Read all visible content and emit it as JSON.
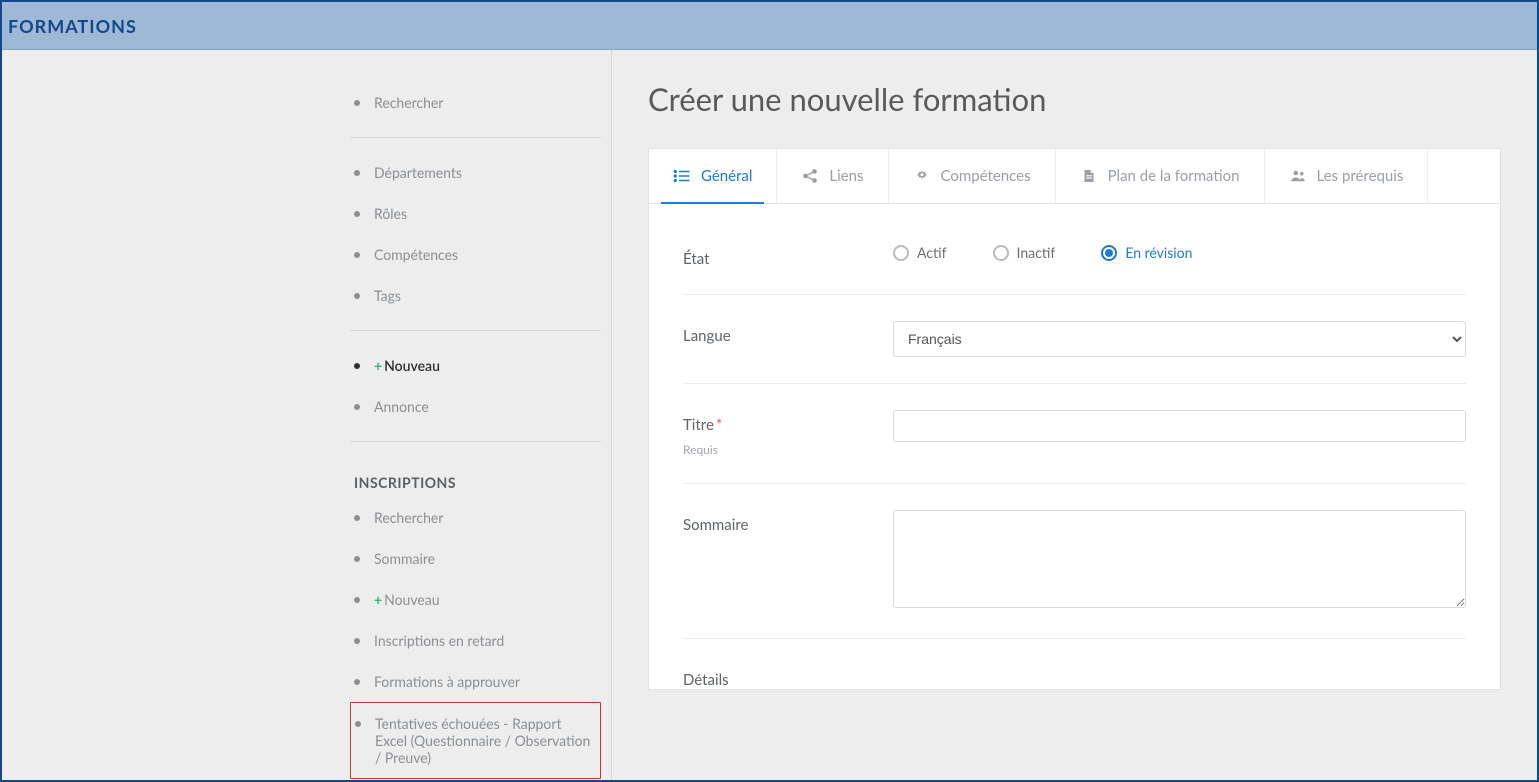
{
  "header": {
    "title": "FORMATIONS"
  },
  "sidebar": {
    "group1": [
      {
        "label": "Rechercher",
        "active": false,
        "plus": false
      }
    ],
    "group2": [
      {
        "label": "Départements",
        "active": false,
        "plus": false
      },
      {
        "label": "Rôles",
        "active": false,
        "plus": false
      },
      {
        "label": "Compétences",
        "active": false,
        "plus": false
      },
      {
        "label": "Tags",
        "active": false,
        "plus": false
      }
    ],
    "group3": [
      {
        "label": "Nouveau",
        "active": true,
        "plus": true
      },
      {
        "label": "Annonce",
        "active": false,
        "plus": false
      }
    ],
    "section_title": "INSCRIPTIONS",
    "group4": [
      {
        "label": "Rechercher",
        "active": false,
        "plus": false
      },
      {
        "label": "Sommaire",
        "active": false,
        "plus": false
      },
      {
        "label": "Nouveau",
        "active": false,
        "plus": true
      },
      {
        "label": "Inscriptions en retard",
        "active": false,
        "plus": false
      },
      {
        "label": "Formations à approuver",
        "active": false,
        "plus": false
      },
      {
        "label": "Tentatives échouées - Rapport Excel (Questionnaire / Observation / Preuve)",
        "active": false,
        "plus": false,
        "highlighted": true
      }
    ]
  },
  "main": {
    "page_title": "Créer une nouvelle formation",
    "tabs": [
      {
        "label": "Général",
        "icon": "list",
        "active": true
      },
      {
        "label": "Liens",
        "icon": "share",
        "active": false
      },
      {
        "label": "Compétences",
        "icon": "gear",
        "active": false
      },
      {
        "label": "Plan de la formation",
        "icon": "file",
        "active": false
      },
      {
        "label": "Les prérequis",
        "icon": "users",
        "active": false
      }
    ],
    "form": {
      "etat": {
        "label": "État",
        "options": [
          {
            "label": "Actif",
            "checked": false
          },
          {
            "label": "Inactif",
            "checked": false
          },
          {
            "label": "En révision",
            "checked": true
          }
        ]
      },
      "langue": {
        "label": "Langue",
        "selected": "Français",
        "options": [
          "Français"
        ]
      },
      "titre": {
        "label": "Titre",
        "required_mark": "*",
        "hint": "Requis",
        "value": ""
      },
      "sommaire": {
        "label": "Sommaire",
        "value": ""
      },
      "details": {
        "label": "Détails",
        "value": ""
      }
    }
  }
}
